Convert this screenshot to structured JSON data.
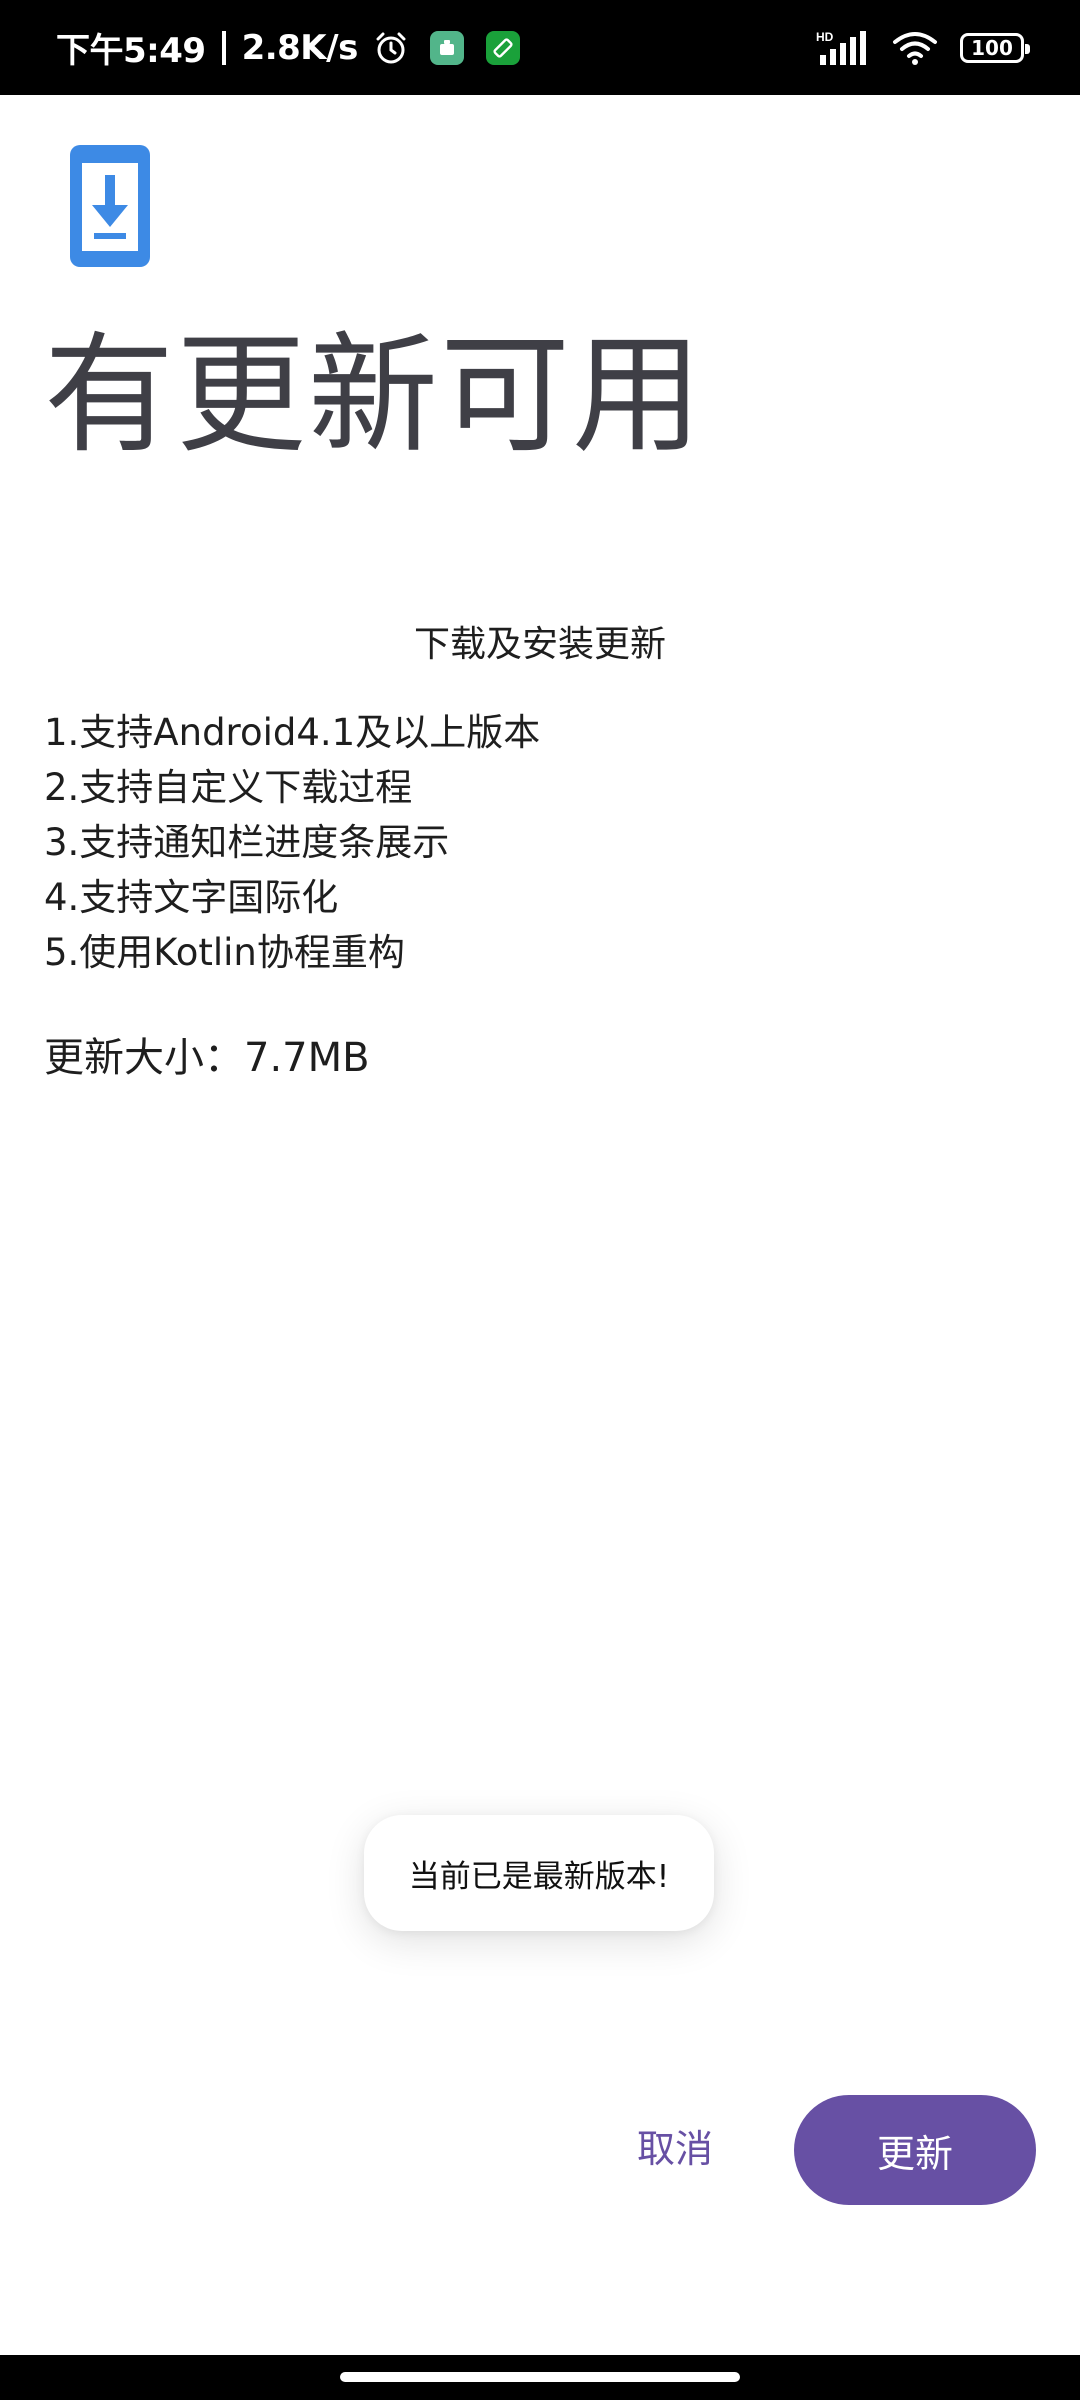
{
  "status_bar": {
    "time": "下午5:49",
    "net_speed": "2.8K/s",
    "battery": "100",
    "signal_badge": "HD",
    "icons": [
      "alarm-icon",
      "app-notification-icon",
      "rotate-screen-icon",
      "signal-icon",
      "wifi-icon",
      "battery-icon"
    ]
  },
  "dialog": {
    "title": "有更新可用",
    "section_heading": "下载及安装更新",
    "notes": [
      "1.支持Android4.1及以上版本",
      "2.支持自定义下载过程",
      "3.支持通知栏进度条展示",
      "4.支持文字国际化",
      "5.使用Kotlin协程重构"
    ],
    "update_size": "更新大小：7.7MB",
    "hero_icon": "download-phone-icon"
  },
  "toast": {
    "message": "当前已是最新版本!"
  },
  "actions": {
    "cancel_label": "取消",
    "update_label": "更新"
  },
  "colors": {
    "accent": "#6750a4",
    "icon_blue": "#3d8ae5",
    "title_text": "#3f3f46"
  }
}
